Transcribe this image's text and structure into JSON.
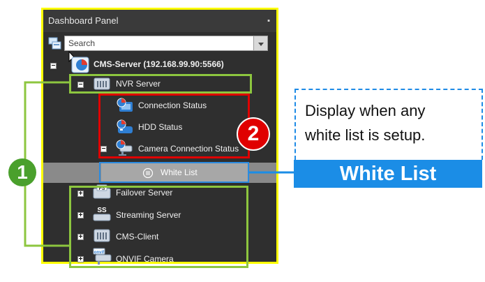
{
  "panel": {
    "title": "Dashboard Panel",
    "pin_glyph": "▪",
    "search_placeholder": "Search"
  },
  "tree": {
    "root": {
      "label": "CMS-Server (192.168.99.90:5566)",
      "expander": "−"
    },
    "nvr": {
      "label": "NVR Server",
      "expander": "−"
    },
    "nvr_children": [
      {
        "label": "Connection Status",
        "icon": "connection-status-icon"
      },
      {
        "label": "HDD Status",
        "icon": "hdd-status-icon"
      },
      {
        "label": "Camera Connection Status",
        "icon": "camera-connection-icon",
        "expander": "−"
      }
    ],
    "white_list": {
      "label": "White List",
      "icon": "white-list-icon"
    },
    "others": [
      {
        "label": "Failover Server",
        "icon": "failover-server-icon",
        "expander": "+"
      },
      {
        "label": "Streaming Server",
        "icon": "streaming-server-icon",
        "expander": "+"
      },
      {
        "label": "CMS-Client",
        "icon": "cms-client-icon",
        "expander": "+"
      },
      {
        "label": "ONVIF Camera",
        "icon": "onvif-camera-icon",
        "expander": "+"
      }
    ]
  },
  "callout": {
    "line1": "Display when any",
    "line2": "white list is setup.",
    "banner": "White List"
  },
  "badges": {
    "one": "1",
    "two": "2"
  },
  "colors": {
    "panel_border": "#ffff00",
    "green_frame": "#8dc63f",
    "red_frame": "#e00000",
    "blue": "#1b8de6"
  }
}
